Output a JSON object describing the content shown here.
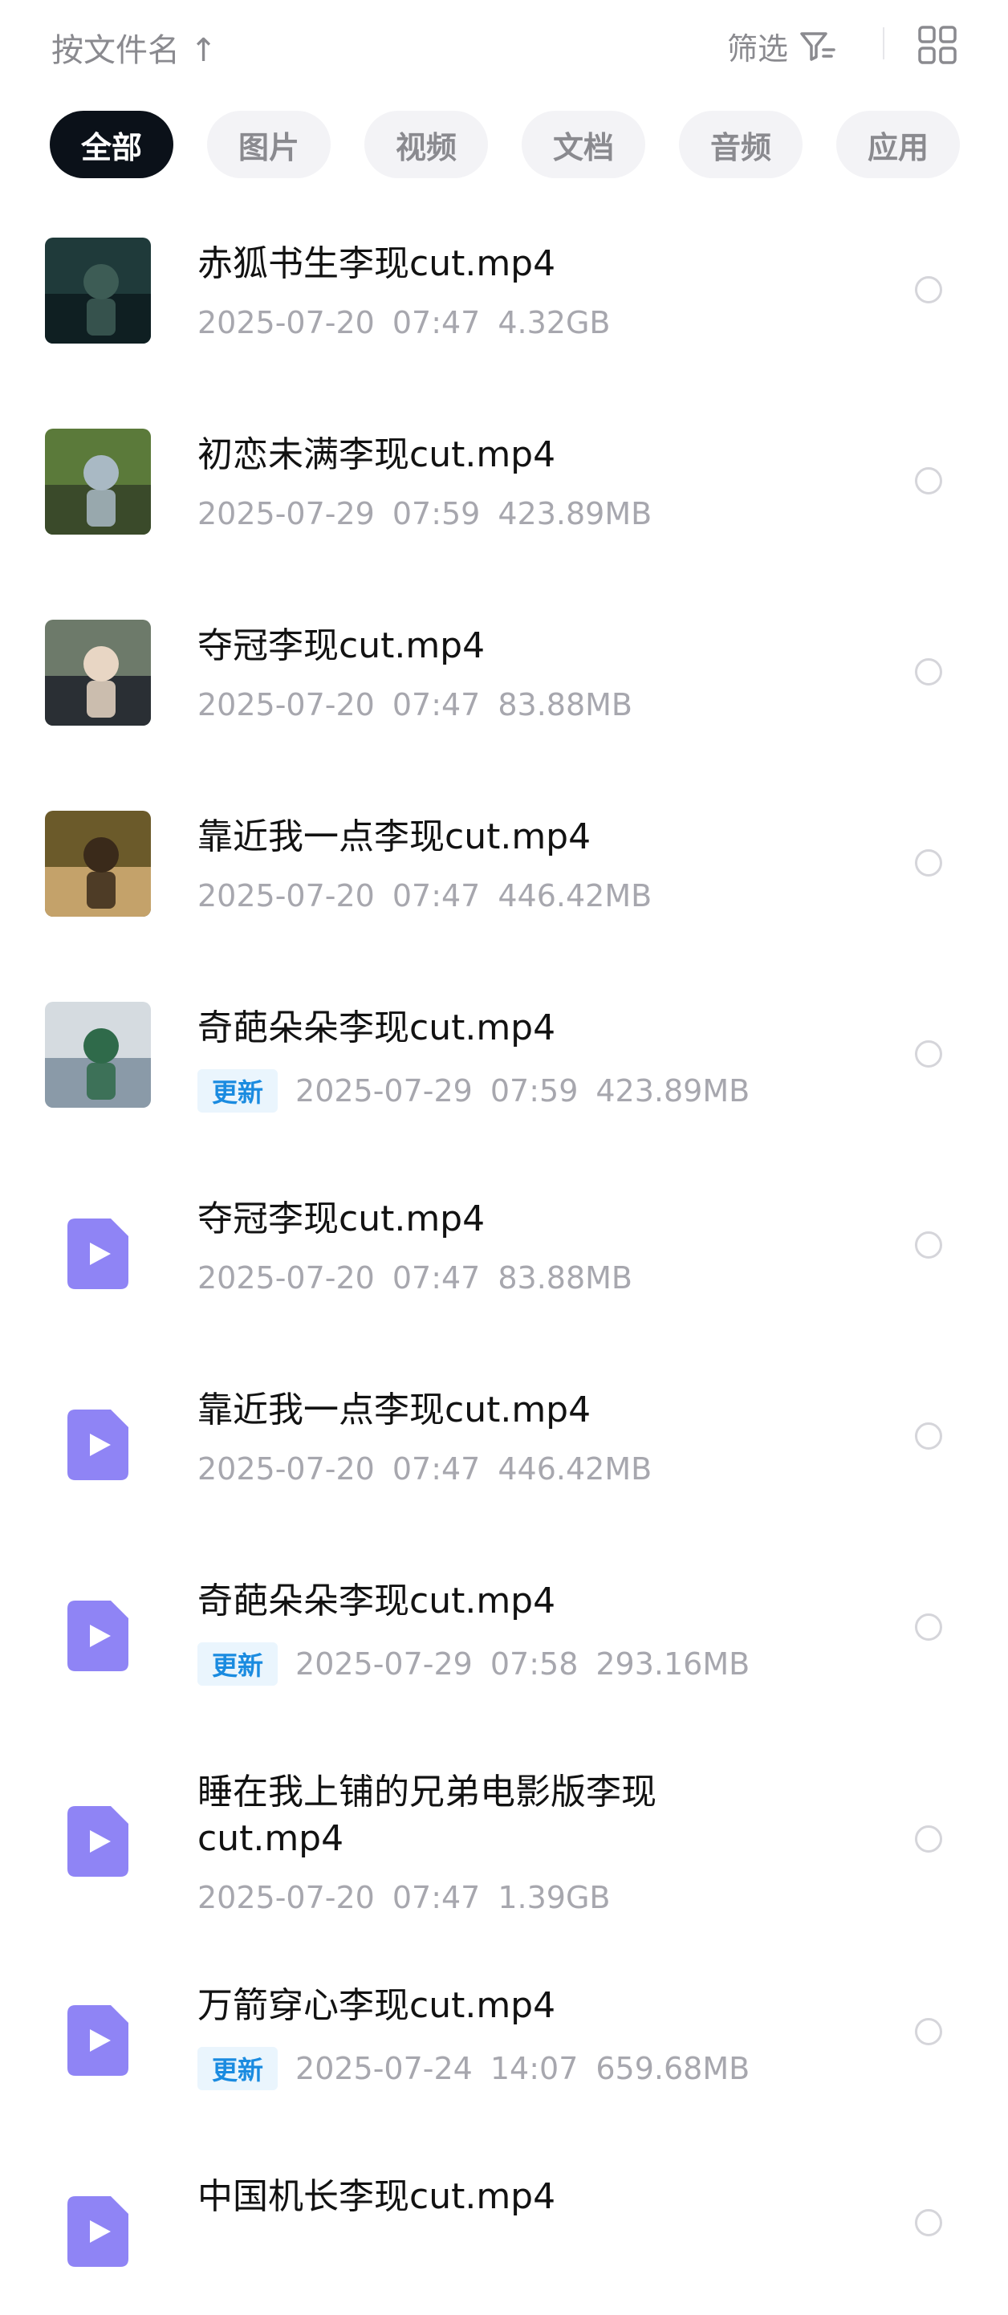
{
  "toolbar": {
    "sort_label": "按文件名 ↑",
    "filter_label": "筛选",
    "icons": [
      "filter-icon",
      "grid-view-icon"
    ]
  },
  "tabs": [
    "全部",
    "图片",
    "视频",
    "文档",
    "音频",
    "应用"
  ],
  "active_tab": "全部",
  "files": [
    {
      "name": "赤狐书生李现cut.mp4",
      "badge": "",
      "date": "2025-07-20",
      "time": "07:47",
      "size": "4.32GB",
      "thumb": "video-thumbnail"
    },
    {
      "name": "初恋未满李现cut.mp4",
      "badge": "",
      "date": "2025-07-29",
      "time": "07:59",
      "size": "423.89MB",
      "thumb": "video-thumbnail"
    },
    {
      "name": "夺冠李现cut.mp4",
      "badge": "",
      "date": "2025-07-20",
      "time": "07:47",
      "size": "83.88MB",
      "thumb": "video-thumbnail"
    },
    {
      "name": "靠近我一点李现cut.mp4",
      "badge": "",
      "date": "2025-07-20",
      "time": "07:47",
      "size": "446.42MB",
      "thumb": "video-thumbnail"
    },
    {
      "name": "奇葩朵朵李现cut.mp4",
      "badge": "更新",
      "date": "2025-07-29",
      "time": "07:59",
      "size": "423.89MB",
      "thumb": "video-thumbnail"
    },
    {
      "name": "夺冠李现cut.mp4",
      "badge": "",
      "date": "2025-07-20",
      "time": "07:47",
      "size": "83.88MB",
      "thumb": "video-file-icon"
    },
    {
      "name": "靠近我一点李现cut.mp4",
      "badge": "",
      "date": "2025-07-20",
      "time": "07:47",
      "size": "446.42MB",
      "thumb": "video-file-icon"
    },
    {
      "name": "奇葩朵朵李现cut.mp4",
      "badge": "更新",
      "date": "2025-07-29",
      "time": "07:58",
      "size": "293.16MB",
      "thumb": "video-file-icon"
    },
    {
      "name": "睡在我上铺的兄弟电影版李现cut.mp4",
      "badge": "",
      "date": "2025-07-20",
      "time": "07:47",
      "size": "1.39GB",
      "thumb": "video-file-icon"
    },
    {
      "name": "万箭穿心李现cut.mp4",
      "badge": "更新",
      "date": "2025-07-24",
      "time": "14:07",
      "size": "659.68MB",
      "thumb": "video-file-icon"
    },
    {
      "name": "中国机长李现cut.mp4",
      "badge": "",
      "date": "",
      "time": "",
      "size": "",
      "thumb": "video-file-icon"
    }
  ],
  "colors": {
    "active_tab_bg": "#0b1119",
    "tab_bg": "#f3f3f6",
    "badge_text": "#1a8be0",
    "badge_bg": "#eaf5fd",
    "video_icon": "#8f84f5"
  }
}
